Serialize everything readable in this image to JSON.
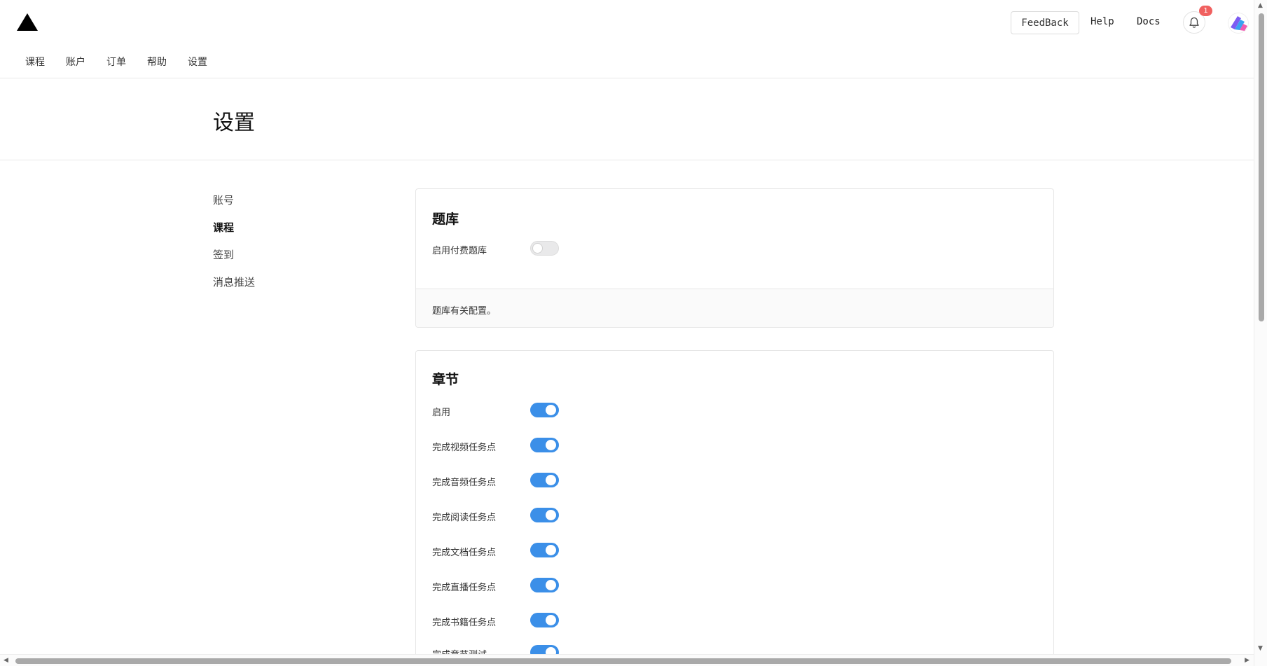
{
  "header": {
    "feedback_label": "FeedBack",
    "help_label": "Help",
    "docs_label": "Docs",
    "notification_count": "1"
  },
  "nav": {
    "tabs": [
      {
        "label": "课程"
      },
      {
        "label": "账户"
      },
      {
        "label": "订单"
      },
      {
        "label": "帮助"
      },
      {
        "label": "设置"
      }
    ]
  },
  "page": {
    "title": "设置"
  },
  "sidemenu": {
    "items": [
      {
        "label": "账号",
        "active": false
      },
      {
        "label": "课程",
        "active": true
      },
      {
        "label": "签到",
        "active": false
      },
      {
        "label": "消息推送",
        "active": false
      }
    ]
  },
  "question_bank": {
    "title": "题库",
    "settings": [
      {
        "label": "启用付费题库",
        "enabled": false
      }
    ],
    "footer_note": "题库有关配置。"
  },
  "chapter": {
    "title": "章节",
    "settings": [
      {
        "label": "启用",
        "enabled": true
      },
      {
        "label": "完成视频任务点",
        "enabled": true
      },
      {
        "label": "完成音频任务点",
        "enabled": true
      },
      {
        "label": "完成阅读任务点",
        "enabled": true
      },
      {
        "label": "完成文档任务点",
        "enabled": true
      },
      {
        "label": "完成直播任务点",
        "enabled": true
      },
      {
        "label": "完成书籍任务点",
        "enabled": true
      },
      {
        "label": "完成章节测试",
        "enabled": true
      }
    ]
  },
  "colors": {
    "toggle_on": "#3b8fe8",
    "toggle_off": "#e9e9ea",
    "badge": "#f0605f"
  }
}
